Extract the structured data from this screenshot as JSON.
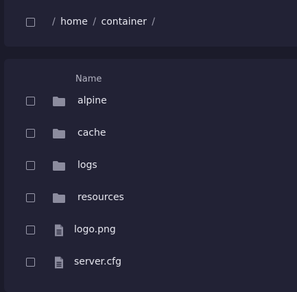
{
  "breadcrumb": {
    "separator": "/",
    "items": [
      "home",
      "container"
    ]
  },
  "table": {
    "column_name": "Name",
    "rows": [
      {
        "name": "alpine",
        "type": "folder",
        "icon": "folder-icon"
      },
      {
        "name": "cache",
        "type": "folder",
        "icon": "folder-icon"
      },
      {
        "name": "logs",
        "type": "folder",
        "icon": "folder-icon"
      },
      {
        "name": "resources",
        "type": "folder",
        "icon": "folder-icon"
      },
      {
        "name": "logo.png",
        "type": "file",
        "icon": "file-icon"
      },
      {
        "name": "server.cfg",
        "type": "file",
        "icon": "file-icon"
      }
    ]
  },
  "colors": {
    "background": "#1b1b2a",
    "panel": "#222235",
    "text": "#e6e6ee",
    "muted": "#9a9aab",
    "icon": "#8c8c9e"
  }
}
